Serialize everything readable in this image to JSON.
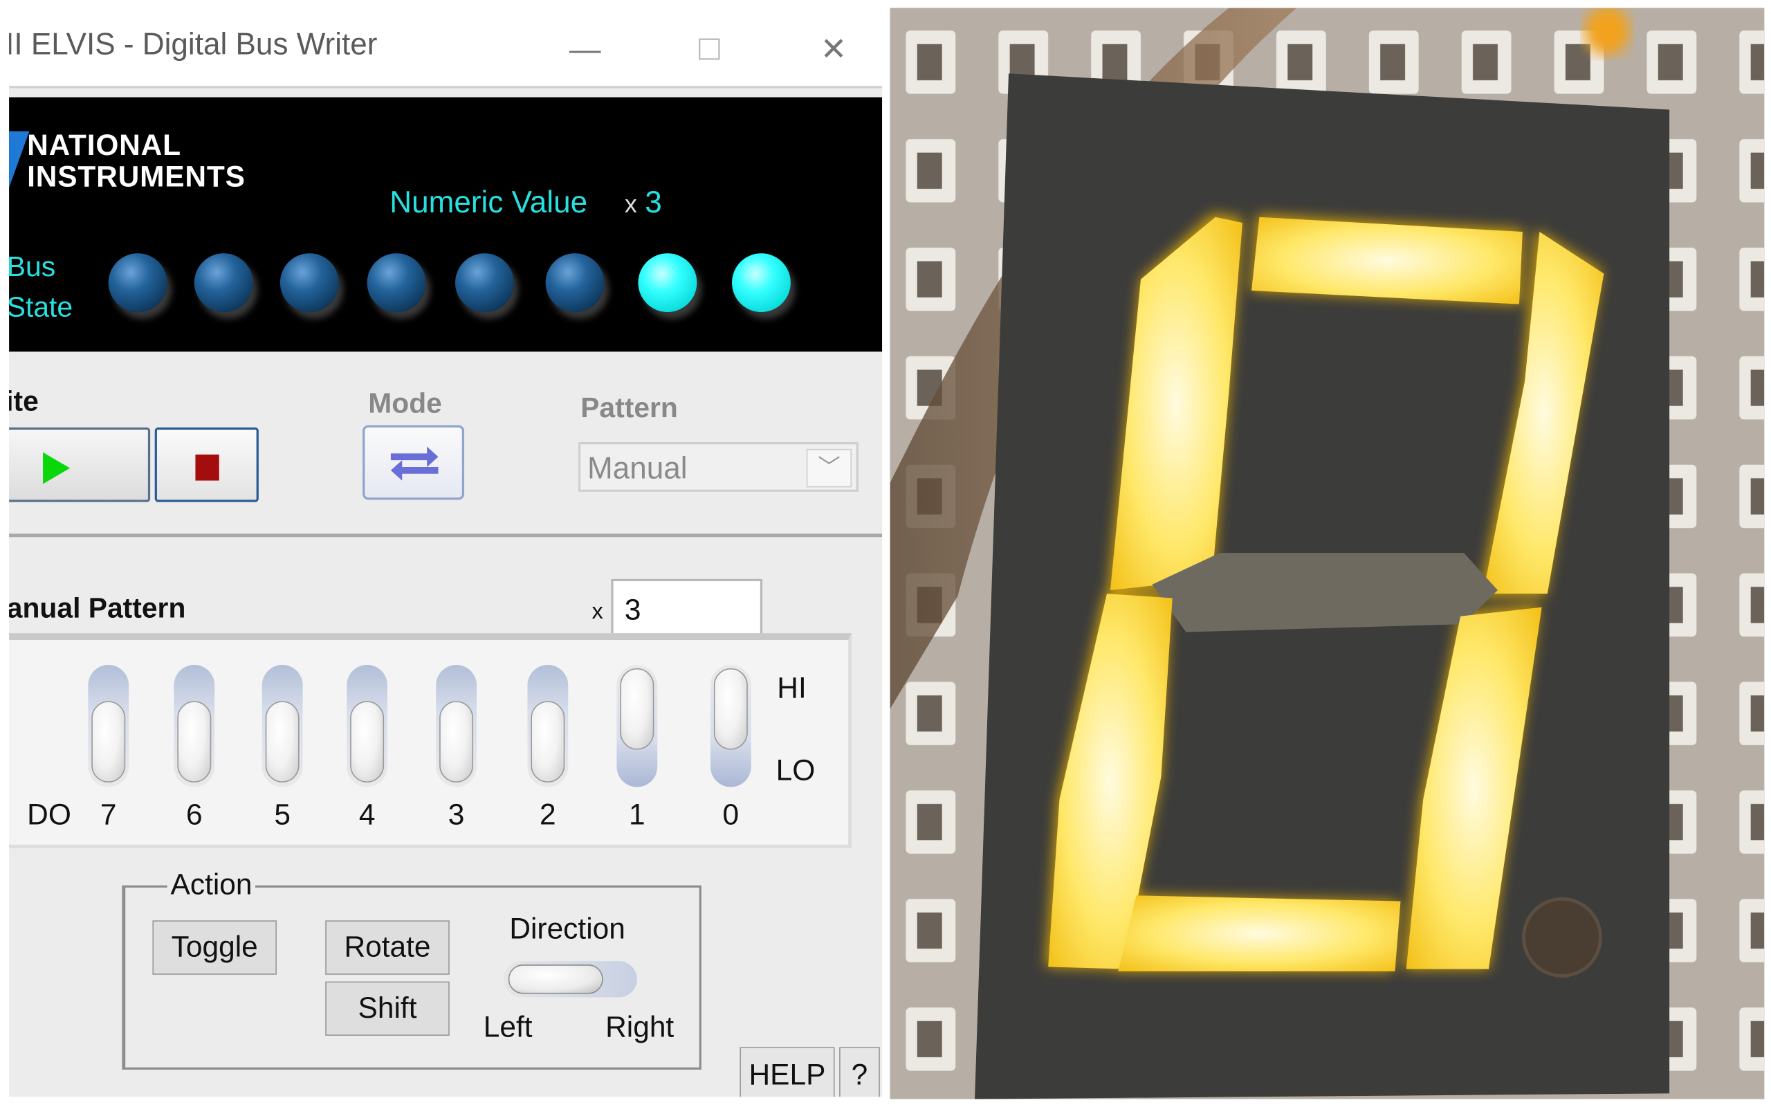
{
  "window": {
    "title": "II ELVIS - Digital Bus Writer",
    "minimize_glyph": "—",
    "maximize_glyph": "☐",
    "close_glyph": "✕"
  },
  "header": {
    "logo_line1": "NATIONAL",
    "logo_line2": "INSTRUMENTS",
    "logo_mark_color": "#1f7ad6",
    "numeric_value_label": "Numeric Value",
    "numeric_value_prefix": "x",
    "numeric_value": "3",
    "bus_state_line1": "Bus",
    "bus_state_line2": "State",
    "leds": [
      false,
      false,
      false,
      false,
      false,
      false,
      true,
      true
    ],
    "label_color": "#27e0e0"
  },
  "controls": {
    "write_label": "ite",
    "mode_label": "Mode",
    "pattern_label": "Pattern",
    "pattern_value": "Manual",
    "play_color": "#0ad70a",
    "stop_color": "#a30d0d"
  },
  "manual_pattern": {
    "label": "anual Pattern",
    "prefix": "x",
    "value": "3",
    "do_label": "DO",
    "hi_label": "HI",
    "lo_label": "LO",
    "bits": [
      {
        "label": "7",
        "state": "LO"
      },
      {
        "label": "6",
        "state": "LO"
      },
      {
        "label": "5",
        "state": "LO"
      },
      {
        "label": "4",
        "state": "LO"
      },
      {
        "label": "3",
        "state": "LO"
      },
      {
        "label": "2",
        "state": "LO"
      },
      {
        "label": "1",
        "state": "HI"
      },
      {
        "label": "0",
        "state": "HI"
      }
    ]
  },
  "action": {
    "label": "Action",
    "toggle": "Toggle",
    "rotate": "Rotate",
    "shift": "Shift",
    "direction": "Direction",
    "left": "Left",
    "right": "Right"
  },
  "footer": {
    "help": "HELP",
    "question": "?"
  },
  "photo": {
    "subject": "seven-segment display",
    "segments_lit": [
      "a",
      "b",
      "c",
      "d",
      "e",
      "f"
    ],
    "segments_unlit": [
      "g"
    ],
    "decimal_point_lit": false,
    "lit_color": "#ffd21f",
    "body_color": "#3c3c3a"
  }
}
